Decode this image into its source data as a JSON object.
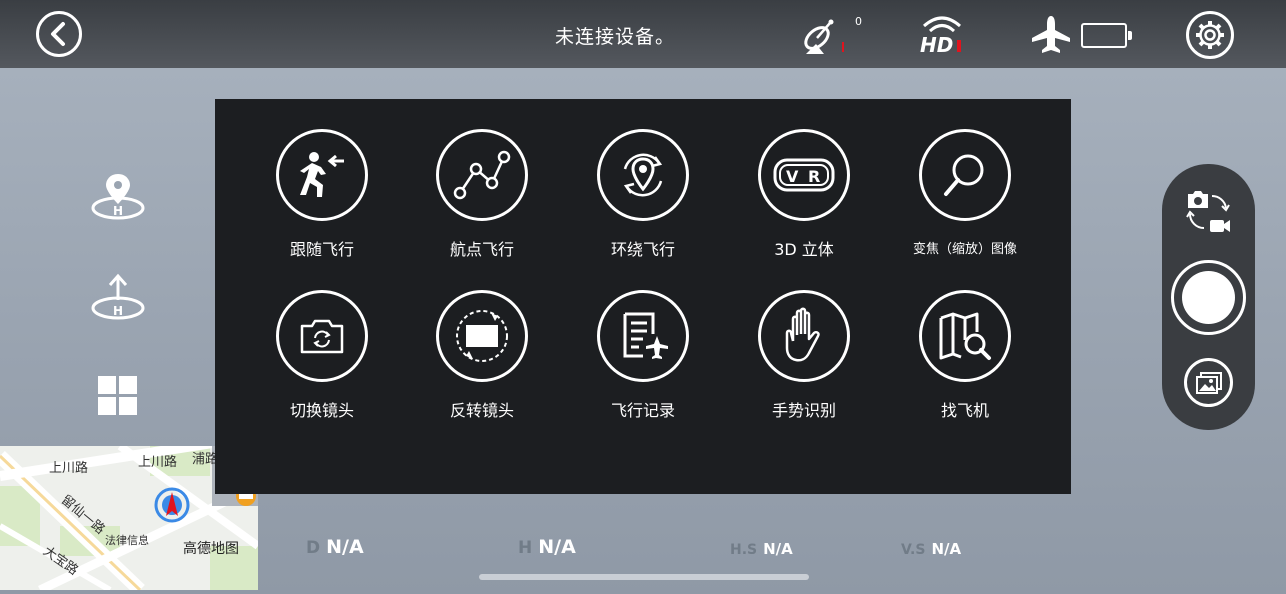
{
  "header": {
    "status_text": "未连接设备。",
    "satellite_count": "0"
  },
  "icons": {
    "back": "chevron-left-icon",
    "satellite": "satellite-dish-icon",
    "hd": "hd-signal-icon",
    "aircraft": "airplane-icon",
    "battery": "battery-icon",
    "settings": "gear-icon"
  },
  "map": {
    "labels": [
      "上川路",
      "上川路",
      "浦路",
      "留仙一路",
      "法律信息",
      "大宝路"
    ],
    "logo": "高德地图"
  },
  "modes": [
    {
      "label": "跟随飞行",
      "icon": "follow-runner-icon"
    },
    {
      "label": "航点飞行",
      "icon": "waypoint-icon"
    },
    {
      "label": "环绕飞行",
      "icon": "orbit-icon"
    },
    {
      "label": "3D 立体",
      "icon": "vr-goggles-icon"
    },
    {
      "label": "变焦（缩放）图像",
      "icon": "zoom-search-icon"
    },
    {
      "label": "切换镜头",
      "icon": "camera-switch-icon"
    },
    {
      "label": "反转镜头",
      "icon": "flip-lens-icon"
    },
    {
      "label": "飞行记录",
      "icon": "flight-log-icon"
    },
    {
      "label": "手势识别",
      "icon": "hand-gesture-icon"
    },
    {
      "label": "找飞机",
      "icon": "find-aircraft-map-icon"
    }
  ],
  "telemetry": [
    {
      "key": "D",
      "value": "N/A"
    },
    {
      "key": "H",
      "value": "N/A"
    },
    {
      "key": "H.S",
      "value": "N/A"
    },
    {
      "key": "V.S",
      "value": "N/A"
    }
  ],
  "colors": {
    "accent_red": "#e0141e",
    "overlay_bg": "#1c1e21"
  }
}
